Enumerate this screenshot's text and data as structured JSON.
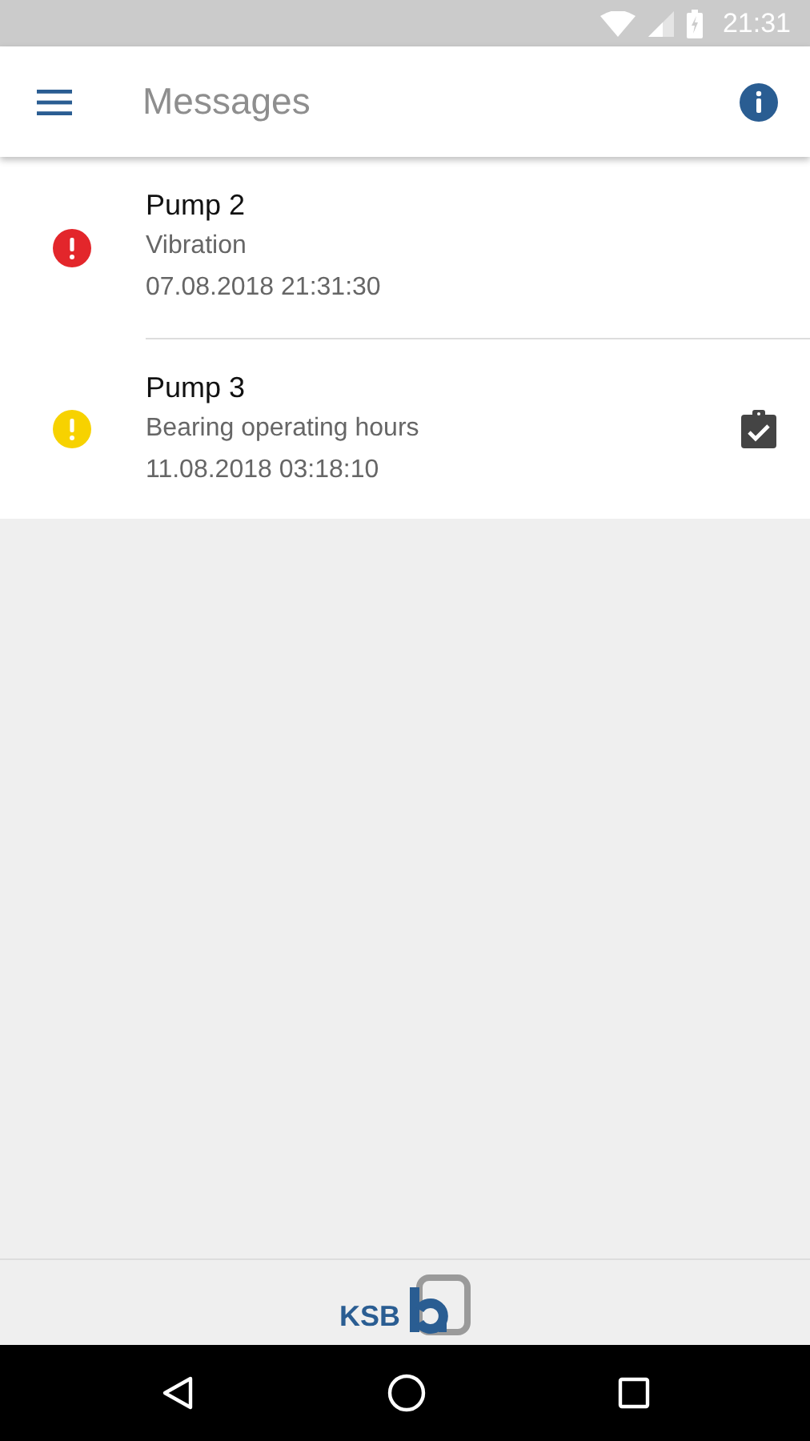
{
  "status_bar": {
    "time": "21:31"
  },
  "app_bar": {
    "title": "Messages"
  },
  "messages": [
    {
      "title": "Pump 2",
      "description": "Vibration",
      "timestamp": "07.08.2018 21:31:30",
      "color": "#e3262b",
      "acknowledged": false
    },
    {
      "title": "Pump 3",
      "description": "Bearing operating hours",
      "timestamp": "11.08.2018 03:18:10",
      "color": "#f7d200",
      "acknowledged": true
    }
  ],
  "footer": {
    "logo_text": "KSB"
  }
}
